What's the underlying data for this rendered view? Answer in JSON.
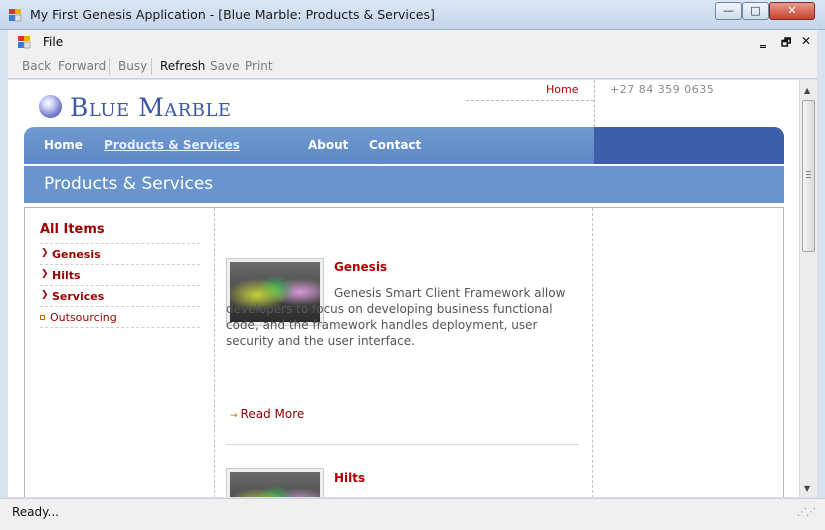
{
  "window": {
    "title": "My First Genesis Application - [Blue Marble: Products & Services]",
    "min": "—",
    "max": "□",
    "close": "✕"
  },
  "menu": {
    "file": "File",
    "mdi_min": "‗",
    "mdi_restore": "🗗",
    "mdi_close": "✕"
  },
  "toolbar": {
    "back": "Back",
    "forward": "Forward",
    "busy": "Busy",
    "refresh": "Refresh",
    "save": "Save",
    "print": "Print"
  },
  "site": {
    "logo": "Blue Marble",
    "top_home": "Home",
    "phone": "+27 84 359 0635"
  },
  "nav": {
    "items": [
      "Home",
      "Products & Services",
      "About",
      "Contact"
    ]
  },
  "page_header": "Products & Services",
  "sidebar": {
    "title": "All Items",
    "items": [
      "Genesis",
      "Hilts",
      "Services",
      "Outsourcing"
    ]
  },
  "products": [
    {
      "title": "Genesis",
      "description": "Genesis Smart Client Framework allow developers to focus on developing business functional code, and the framework handles deployment, user security and the user interface.",
      "read_more": "Read More"
    },
    {
      "title": "Hilts"
    }
  ],
  "status": "Ready...",
  "icons": {
    "app": "app-window-icon",
    "arrow": "chevron-right-icon",
    "bullet": "square-bullet-icon"
  },
  "colors": {
    "brand_blue": "#3d58a8",
    "nav_blue": "#6a95cc",
    "accent_red": "#9b0000"
  }
}
